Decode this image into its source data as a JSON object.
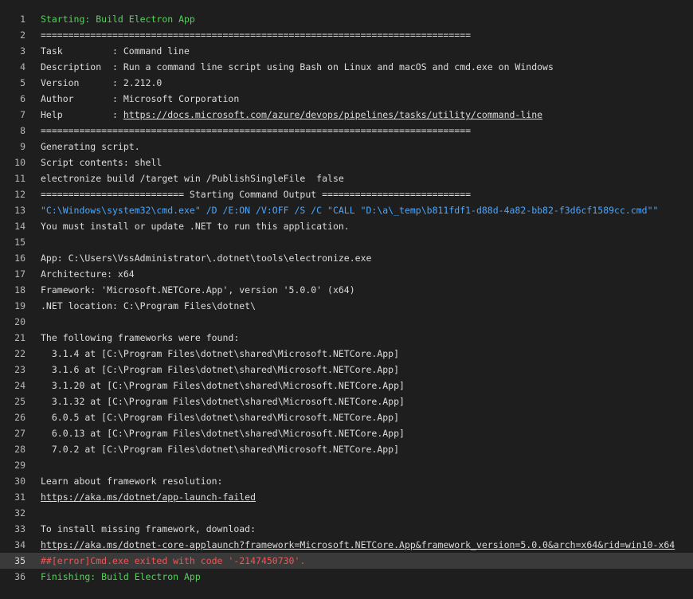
{
  "colors": {
    "background": "#1e1e1e",
    "text": "#dcdcdc",
    "line_number": "#b7b7b7",
    "section_green": "#55d259",
    "command_blue": "#4aa7ff",
    "error_red": "#f05656",
    "error_row_bg": "#3a3a3a"
  },
  "lines": [
    {
      "n": "1",
      "text": "Starting: Build Electron App",
      "style": "green"
    },
    {
      "n": "2",
      "text": "==============================================================================",
      "style": ""
    },
    {
      "n": "3",
      "text": "Task         : Command line",
      "style": ""
    },
    {
      "n": "4",
      "text": "Description  : Run a command line script using Bash on Linux and macOS and cmd.exe on Windows",
      "style": ""
    },
    {
      "n": "5",
      "text": "Version      : 2.212.0",
      "style": ""
    },
    {
      "n": "6",
      "text": "Author       : Microsoft Corporation",
      "style": ""
    },
    {
      "n": "7",
      "text": "Help         : ",
      "link": "https://docs.microsoft.com/azure/devops/pipelines/tasks/utility/command-line",
      "style": ""
    },
    {
      "n": "8",
      "text": "==============================================================================",
      "style": ""
    },
    {
      "n": "9",
      "text": "Generating script.",
      "style": ""
    },
    {
      "n": "10",
      "text": "Script contents: shell",
      "style": ""
    },
    {
      "n": "11",
      "text": "electronize build /target win /PublishSingleFile  false",
      "style": ""
    },
    {
      "n": "12",
      "text": "========================== Starting Command Output ===========================",
      "style": ""
    },
    {
      "n": "13",
      "text": "\"C:\\Windows\\system32\\cmd.exe\" /D /E:ON /V:OFF /S /C \"CALL \"D:\\a\\_temp\\b811fdf1-d88d-4a82-bb82-f3d6cf1589cc.cmd\"\"",
      "style": "blue"
    },
    {
      "n": "14",
      "text": "You must install or update .NET to run this application.",
      "style": ""
    },
    {
      "n": "15",
      "text": "",
      "style": ""
    },
    {
      "n": "16",
      "text": "App: C:\\Users\\VssAdministrator\\.dotnet\\tools\\electronize.exe",
      "style": ""
    },
    {
      "n": "17",
      "text": "Architecture: x64",
      "style": ""
    },
    {
      "n": "18",
      "text": "Framework: 'Microsoft.NETCore.App', version '5.0.0' (x64)",
      "style": ""
    },
    {
      "n": "19",
      "text": ".NET location: C:\\Program Files\\dotnet\\",
      "style": ""
    },
    {
      "n": "20",
      "text": "",
      "style": ""
    },
    {
      "n": "21",
      "text": "The following frameworks were found:",
      "style": ""
    },
    {
      "n": "22",
      "text": "  3.1.4 at [C:\\Program Files\\dotnet\\shared\\Microsoft.NETCore.App]",
      "style": ""
    },
    {
      "n": "23",
      "text": "  3.1.6 at [C:\\Program Files\\dotnet\\shared\\Microsoft.NETCore.App]",
      "style": ""
    },
    {
      "n": "24",
      "text": "  3.1.20 at [C:\\Program Files\\dotnet\\shared\\Microsoft.NETCore.App]",
      "style": ""
    },
    {
      "n": "25",
      "text": "  3.1.32 at [C:\\Program Files\\dotnet\\shared\\Microsoft.NETCore.App]",
      "style": ""
    },
    {
      "n": "26",
      "text": "  6.0.5 at [C:\\Program Files\\dotnet\\shared\\Microsoft.NETCore.App]",
      "style": ""
    },
    {
      "n": "27",
      "text": "  6.0.13 at [C:\\Program Files\\dotnet\\shared\\Microsoft.NETCore.App]",
      "style": ""
    },
    {
      "n": "28",
      "text": "  7.0.2 at [C:\\Program Files\\dotnet\\shared\\Microsoft.NETCore.App]",
      "style": ""
    },
    {
      "n": "29",
      "text": "",
      "style": ""
    },
    {
      "n": "30",
      "text": "Learn about framework resolution:",
      "style": ""
    },
    {
      "n": "31",
      "text": "",
      "link": "https://aka.ms/dotnet/app-launch-failed",
      "style": ""
    },
    {
      "n": "32",
      "text": "",
      "style": ""
    },
    {
      "n": "33",
      "text": "To install missing framework, download:",
      "style": ""
    },
    {
      "n": "34",
      "text": "",
      "link": "https://aka.ms/dotnet-core-applaunch?framework=Microsoft.NETCore.App&framework_version=5.0.0&arch=x64&rid=win10-x64",
      "style": ""
    },
    {
      "n": "35",
      "text": "##[error]Cmd.exe exited with code '-2147450730'.",
      "style": "red"
    },
    {
      "n": "36",
      "text": "Finishing: Build Electron App",
      "style": "green"
    }
  ]
}
